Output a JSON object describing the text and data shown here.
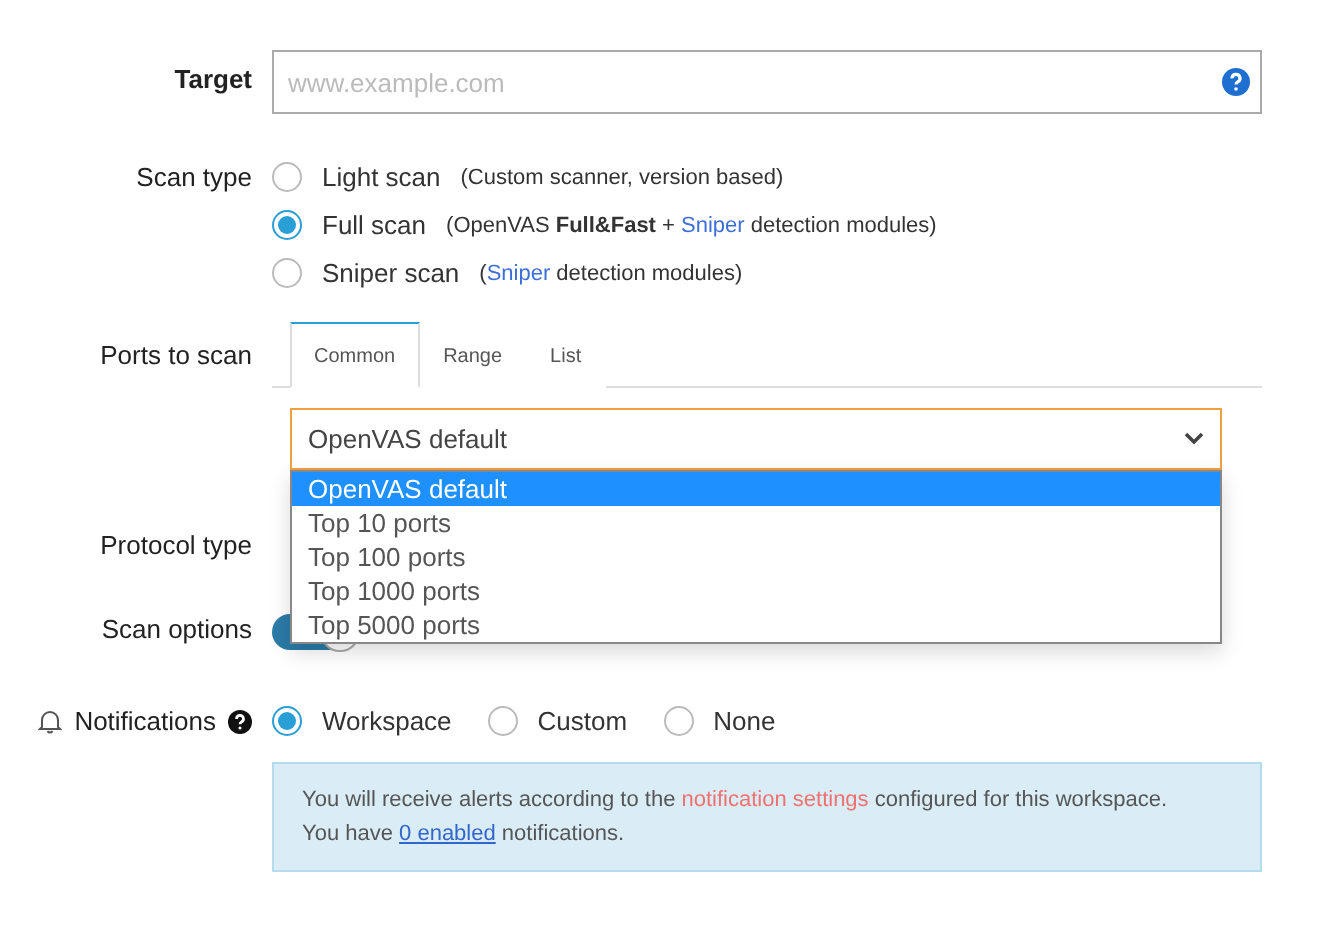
{
  "target": {
    "label": "Target",
    "placeholder": "www.example.com"
  },
  "scan_type": {
    "label": "Scan type",
    "options": [
      {
        "label": "Light scan",
        "selected": false,
        "description": [
          {
            "text": "(Custom scanner, version based)",
            "kind": "plain"
          }
        ]
      },
      {
        "label": "Full scan",
        "selected": true,
        "description": [
          {
            "text": "(OpenVAS ",
            "kind": "plain"
          },
          {
            "text": "Full&Fast",
            "kind": "bold"
          },
          {
            "text": " + ",
            "kind": "plain"
          },
          {
            "text": "Sniper",
            "kind": "accent"
          },
          {
            "text": " detection modules)",
            "kind": "plain"
          }
        ]
      },
      {
        "label": "Sniper scan",
        "selected": false,
        "description": [
          {
            "text": "(",
            "kind": "plain"
          },
          {
            "text": "Sniper",
            "kind": "accent"
          },
          {
            "text": " detection modules)",
            "kind": "plain"
          }
        ]
      }
    ]
  },
  "ports": {
    "label": "Ports to scan",
    "tabs": [
      {
        "label": "Common",
        "selected": true
      },
      {
        "label": "Range",
        "selected": false
      },
      {
        "label": "List",
        "selected": false
      }
    ],
    "select": {
      "value": "OpenVAS default",
      "expanded": true,
      "options": [
        {
          "label": "OpenVAS default",
          "selected": true
        },
        {
          "label": "Top 10 ports",
          "selected": false
        },
        {
          "label": "Top 100 ports",
          "selected": false
        },
        {
          "label": "Top 1000 ports",
          "selected": false
        },
        {
          "label": "Top 5000 ports",
          "selected": false
        }
      ]
    }
  },
  "protocol_type": {
    "label": "Protocol type"
  },
  "scan_options": {
    "label": "Scan options",
    "toggle_on": true
  },
  "notifications": {
    "label": "Notifications",
    "options": [
      {
        "label": "Workspace",
        "selected": true
      },
      {
        "label": "Custom",
        "selected": false
      },
      {
        "label": "None",
        "selected": false
      }
    ],
    "notice": [
      [
        {
          "text": "You will receive alerts according to the ",
          "kind": "plain"
        },
        {
          "text": "notification settings",
          "kind": "link"
        },
        {
          "text": " configured for this workspace.",
          "kind": "plain"
        }
      ],
      [
        {
          "text": "You have ",
          "kind": "plain"
        },
        {
          "text": "0 enabled",
          "kind": "underline"
        },
        {
          "text": " notifications.",
          "kind": "plain"
        }
      ]
    ]
  }
}
